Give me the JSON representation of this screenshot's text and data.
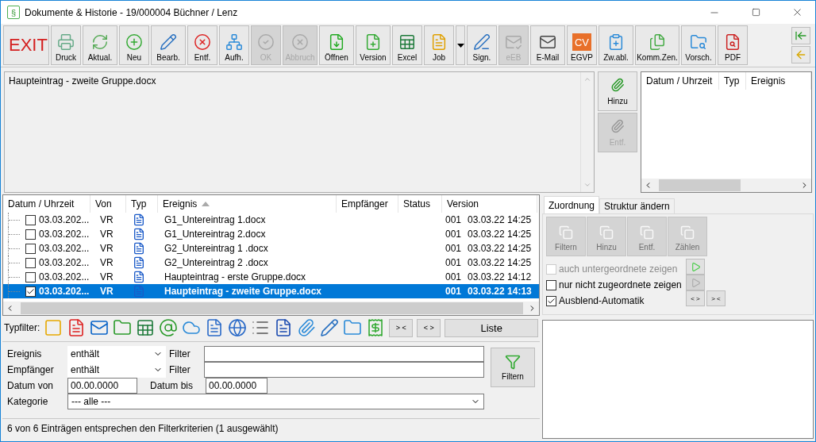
{
  "window": {
    "app_icon": "§",
    "title": "Dokumente & Historie - 19/000004  Büchner / Lenz"
  },
  "toolbar": [
    {
      "kind": "exit",
      "label": "EXIT",
      "disabled": false
    },
    {
      "kind": "icon",
      "label": "Druck",
      "disabled": false
    },
    {
      "kind": "icon",
      "label": "Aktual.",
      "disabled": false
    },
    {
      "kind": "icon",
      "label": "Neu",
      "disabled": false
    },
    {
      "kind": "icon",
      "label": "Bearb.",
      "disabled": false
    },
    {
      "kind": "icon",
      "label": "Entf.",
      "disabled": false
    },
    {
      "kind": "icon",
      "label": "Aufh.",
      "disabled": false
    },
    {
      "kind": "icon",
      "label": "OK",
      "disabled": true
    },
    {
      "kind": "icon",
      "label": "Abbruch",
      "disabled": true
    },
    {
      "kind": "icon",
      "label": "Öffnen",
      "disabled": false
    },
    {
      "kind": "icon",
      "label": "Version",
      "disabled": false
    },
    {
      "kind": "icon",
      "label": "Excel",
      "disabled": false
    },
    {
      "kind": "icon",
      "label": "Job",
      "disabled": false
    },
    {
      "kind": "dropdown",
      "disabled": false
    },
    {
      "kind": "icon",
      "label": "Sign.",
      "disabled": false
    },
    {
      "kind": "icon",
      "label": "eEB",
      "disabled": true
    },
    {
      "kind": "icon",
      "label": "E-Mail",
      "disabled": false
    },
    {
      "kind": "badge",
      "badge": "CV",
      "label": "EGVP",
      "disabled": false
    },
    {
      "kind": "icon",
      "label": "Zw.abl.",
      "disabled": false
    },
    {
      "kind": "icon",
      "label": "Komm.Zen.",
      "disabled": false
    },
    {
      "kind": "icon",
      "label": "Vorsch.",
      "disabled": false
    },
    {
      "kind": "icon",
      "label": "PDF",
      "disabled": false
    }
  ],
  "note": {
    "text": "Haupteintrag - zweite Gruppe.docx"
  },
  "side_buttons": [
    {
      "label": "Hinzu",
      "disabled": false
    },
    {
      "label": "Entf.",
      "disabled": true
    }
  ],
  "history_list": {
    "columns": [
      "Datum / Uhrzeit",
      "Typ",
      "Ereignis"
    ]
  },
  "table": {
    "columns": [
      {
        "label": "Datum / Uhrzeit",
        "sorted": false
      },
      {
        "label": "Von",
        "sorted": false
      },
      {
        "label": "Typ",
        "sorted": false
      },
      {
        "label": "Ereignis",
        "sorted": true
      },
      {
        "label": "Empfänger",
        "sorted": false
      },
      {
        "label": "Status",
        "sorted": false
      },
      {
        "label": "Version",
        "sorted": false
      }
    ],
    "rows": [
      {
        "date": "03.03.202...",
        "from": "VR",
        "event": "G1_Untereintrag 1.docx",
        "version": "001",
        "version_date": "03.03.22 14:25",
        "checked": false,
        "selected": false
      },
      {
        "date": "03.03.202...",
        "from": "VR",
        "event": "G1_Untereintrag 2.docx",
        "version": "001",
        "version_date": "03.03.22 14:25",
        "checked": false,
        "selected": false
      },
      {
        "date": "03.03.202...",
        "from": "VR",
        "event": "G2_Untereintrag 1 .docx",
        "version": "001",
        "version_date": "03.03.22 14:25",
        "checked": false,
        "selected": false
      },
      {
        "date": "03.03.202...",
        "from": "VR",
        "event": "G2_Untereintrag 2 .docx",
        "version": "001",
        "version_date": "03.03.22 14:25",
        "checked": false,
        "selected": false
      },
      {
        "date": "03.03.202...",
        "from": "VR",
        "event": "Haupteintrag - erste Gruppe.docx",
        "version": "001",
        "version_date": "03.03.22 14:12",
        "checked": false,
        "selected": false
      },
      {
        "date": "03.03.202...",
        "from": "VR",
        "event": "Haupteintrag - zweite Gruppe.docx",
        "version": "001",
        "version_date": "03.03.22 14:13",
        "checked": true,
        "selected": true
      }
    ]
  },
  "type_filter": {
    "label": "Typfilter:",
    "buttons": [
      "> <",
      "< >",
      "Liste"
    ]
  },
  "filter_form": {
    "rows": [
      {
        "label": "Ereignis",
        "operator": "enthält",
        "filter_label": "Filter"
      },
      {
        "label": "Empfänger",
        "operator": "enthält",
        "filter_label": "Filter"
      }
    ],
    "date_from": {
      "label": "Datum von",
      "value": "00.00.0000"
    },
    "date_to": {
      "label": "Datum bis",
      "value": "00.00.0000"
    },
    "category": {
      "label": "Kategorie",
      "value": "--- alle ---"
    },
    "filter_button": "Filtern"
  },
  "status_bar": "6 von 6 Einträgen entsprechen den Filterkriterien (1 ausgewählt)",
  "tabs": [
    {
      "label": "Zuordnung",
      "selected": true
    },
    {
      "label": "Struktur ändern",
      "selected": false
    }
  ],
  "assign_buttons": [
    {
      "label": "Filtern",
      "disabled": true
    },
    {
      "label": "Hinzu",
      "disabled": true
    },
    {
      "label": "Entf.",
      "disabled": true
    },
    {
      "label": "Zählen",
      "disabled": true
    }
  ],
  "options": [
    {
      "label": "auch untergeordnete zeigen",
      "checked": false,
      "disabled": true
    },
    {
      "label": "nur nicht zugeordnete zeigen",
      "checked": false,
      "disabled": false
    },
    {
      "label": "Ausblend-Automatik",
      "checked": true,
      "disabled": false
    }
  ],
  "option_buttons": [
    {
      "kind": "play",
      "disabled": false
    },
    {
      "kind": "play",
      "disabled": true
    },
    {
      "kind": "text",
      "label": "< >",
      "disabled": false
    },
    {
      "kind": "text",
      "label": "> <",
      "disabled": false
    }
  ]
}
